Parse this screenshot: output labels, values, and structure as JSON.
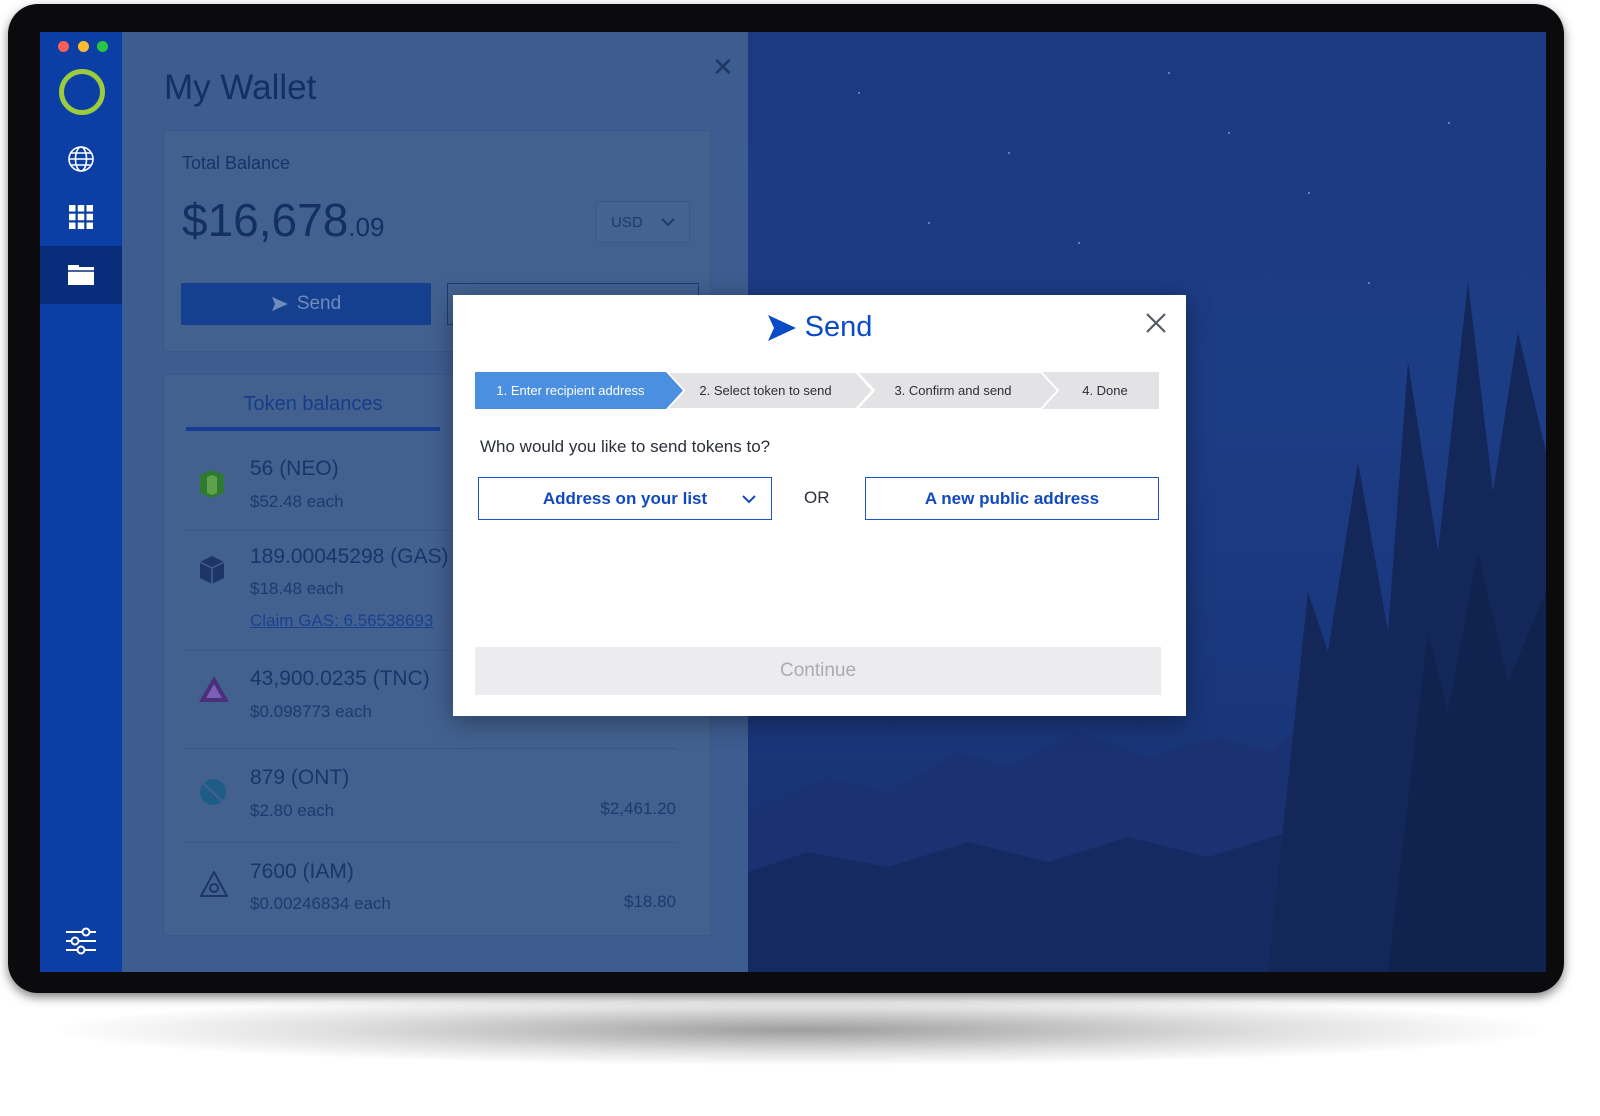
{
  "sidebar": {
    "items": [
      {
        "icon": "globe-icon"
      },
      {
        "icon": "apps-grid-icon"
      },
      {
        "icon": "wallet-folder-icon",
        "active": true
      },
      {
        "icon": "settings-sliders-icon"
      }
    ]
  },
  "wallet": {
    "title": "My Wallet",
    "balance_label": "Total Balance",
    "balance_main": "$16,678",
    "balance_cents": ".09",
    "currency": "USD",
    "send_label": "Send",
    "tab_label": "Token balances",
    "tokens": [
      {
        "name": "56 (NEO)",
        "price": "$52.48 each",
        "claim": "",
        "value": "",
        "icon": "neo-icon",
        "color": "#3d8a3a"
      },
      {
        "name": "189.00045298 (GAS)",
        "price": "$18.48 each",
        "claim": "Claim GAS: 6.56538693",
        "value": "",
        "icon": "gas-icon",
        "color": "#1e3568"
      },
      {
        "name": "43,900.0235 (TNC)",
        "price": "$0.098773 each",
        "claim": "",
        "value": "",
        "icon": "tnc-icon",
        "color": "#4a2f7a"
      },
      {
        "name": "879 (ONT)",
        "price": "$2.80 each",
        "claim": "",
        "value": "$2,461.20",
        "icon": "ont-icon",
        "color": "#1e5c86"
      },
      {
        "name": "7600 (IAM)",
        "price": "$0.00246834 each",
        "claim": "",
        "value": "$18.80",
        "icon": "iam-icon",
        "color": "#1e3568"
      }
    ]
  },
  "modal": {
    "title": "Send",
    "steps": [
      {
        "label": "1. Enter recipient address",
        "active": true
      },
      {
        "label": "2. Select token to send",
        "active": false
      },
      {
        "label": "3. Confirm and send",
        "active": false
      },
      {
        "label": "4. Done",
        "active": false
      }
    ],
    "question": "Who would you like to send tokens to?",
    "address_list_label": "Address on your list",
    "or_label": "OR",
    "new_address_label": "A new public address",
    "continue_label": "Continue"
  },
  "colors": {
    "accent": "#0c4bc8",
    "step_active": "#4a8fe0",
    "step_inactive": "#e3e3e6",
    "sidebar": "#0c3fa6",
    "logo": "#9ccc3d"
  }
}
